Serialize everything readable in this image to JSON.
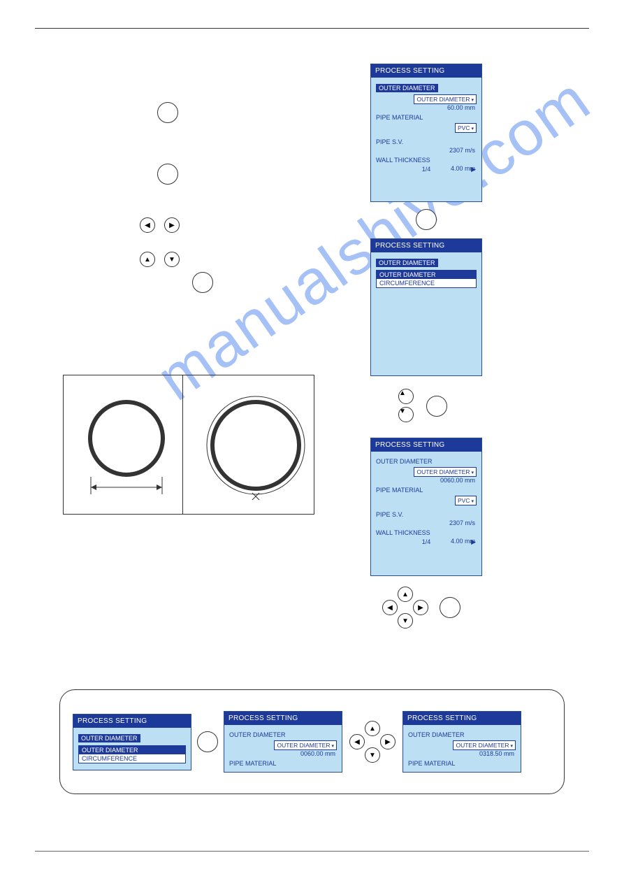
{
  "watermark": "manualshive.com",
  "hdr": "PROCESS SETTING",
  "footer_page": "1/4",
  "labels": {
    "outer_diameter": "OUTER DIAMETER",
    "circumference": "CIRCUMFERENCE",
    "pipe_material": "PIPE MATERIAL",
    "pipe_sv": "PIPE S.V.",
    "wall_thickness": "WALL THICKNESS"
  },
  "values": {
    "outer_diameter_1": "60.00 mm",
    "outer_diameter_3": "0060.00 mm",
    "outer_diameter_strip_b": "0060.00 mm",
    "outer_diameter_strip_c": "0318.50 mm",
    "pipe_material": "PVC",
    "pipe_sv": "2307 m/s",
    "wall_thickness": "4.00 mm"
  },
  "arrows": {
    "left": "◀",
    "right": "▶",
    "up": "▲",
    "down": "▼"
  }
}
